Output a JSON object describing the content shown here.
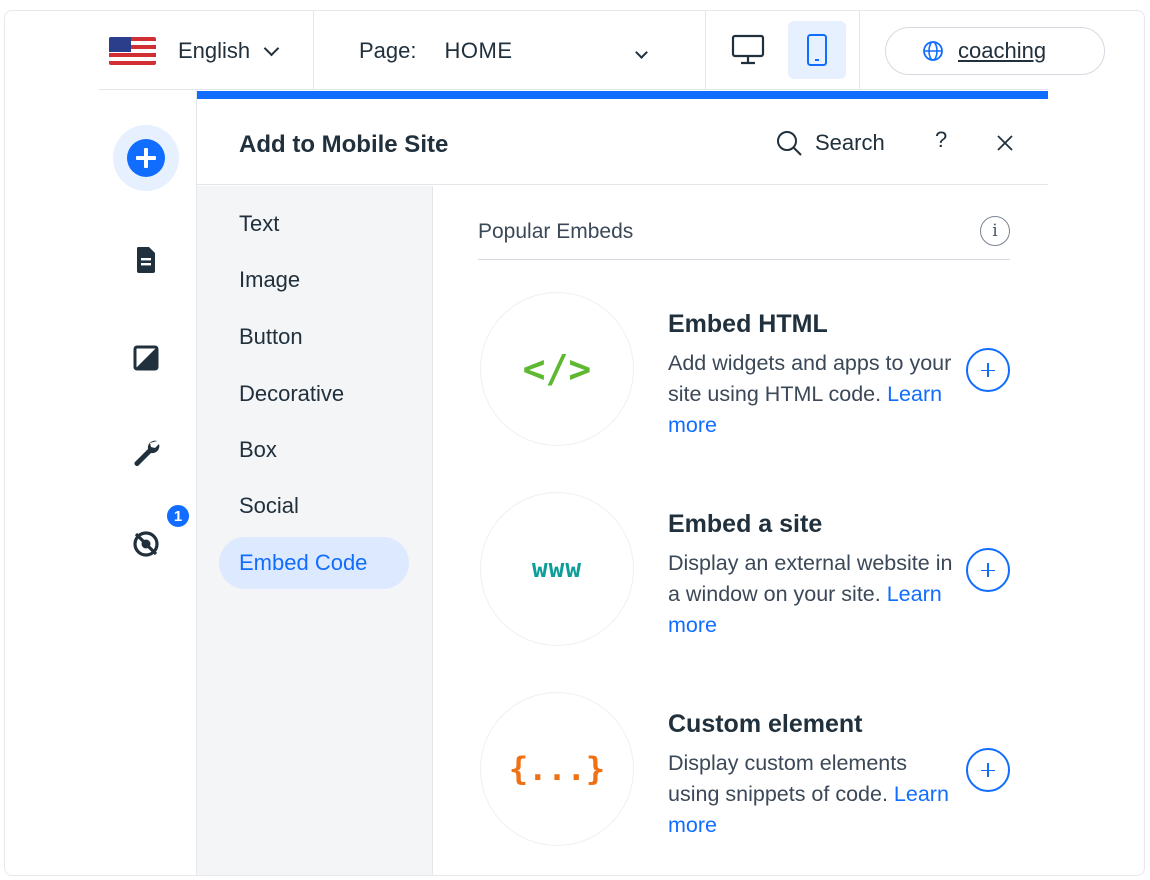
{
  "topbar": {
    "language": "English",
    "page_prefix": "Page:",
    "page_name": "HOME",
    "site_url": "coaching"
  },
  "rail": {
    "hidden_elements_badge": "1"
  },
  "panel": {
    "title": "Add to Mobile Site",
    "search_label": "Search",
    "help_label": "?",
    "categories": [
      {
        "label": "Text"
      },
      {
        "label": "Image"
      },
      {
        "label": "Button"
      },
      {
        "label": "Decorative"
      },
      {
        "label": "Box"
      },
      {
        "label": "Social"
      },
      {
        "label": "Embed Code",
        "active": true
      }
    ],
    "section_title": "Popular Embeds",
    "embeds": [
      {
        "title": "Embed HTML",
        "description": "Add widgets and apps to your site using HTML code.",
        "learn_more": "Learn more",
        "glyph": "</>",
        "glyph_color": "#5fb832"
      },
      {
        "title": "Embed a site",
        "description": "Display an external website in a window on your site.",
        "learn_more": "Learn more",
        "glyph": "www",
        "glyph_color": "#0e9e9a"
      },
      {
        "title": "Custom element",
        "description": "Display custom elements using snippets of code.",
        "learn_more": "Learn more",
        "glyph": "{...}",
        "glyph_color": "#f07113"
      }
    ]
  },
  "colors": {
    "accent": "#116dff",
    "accent_light": "#e7f0ff"
  }
}
